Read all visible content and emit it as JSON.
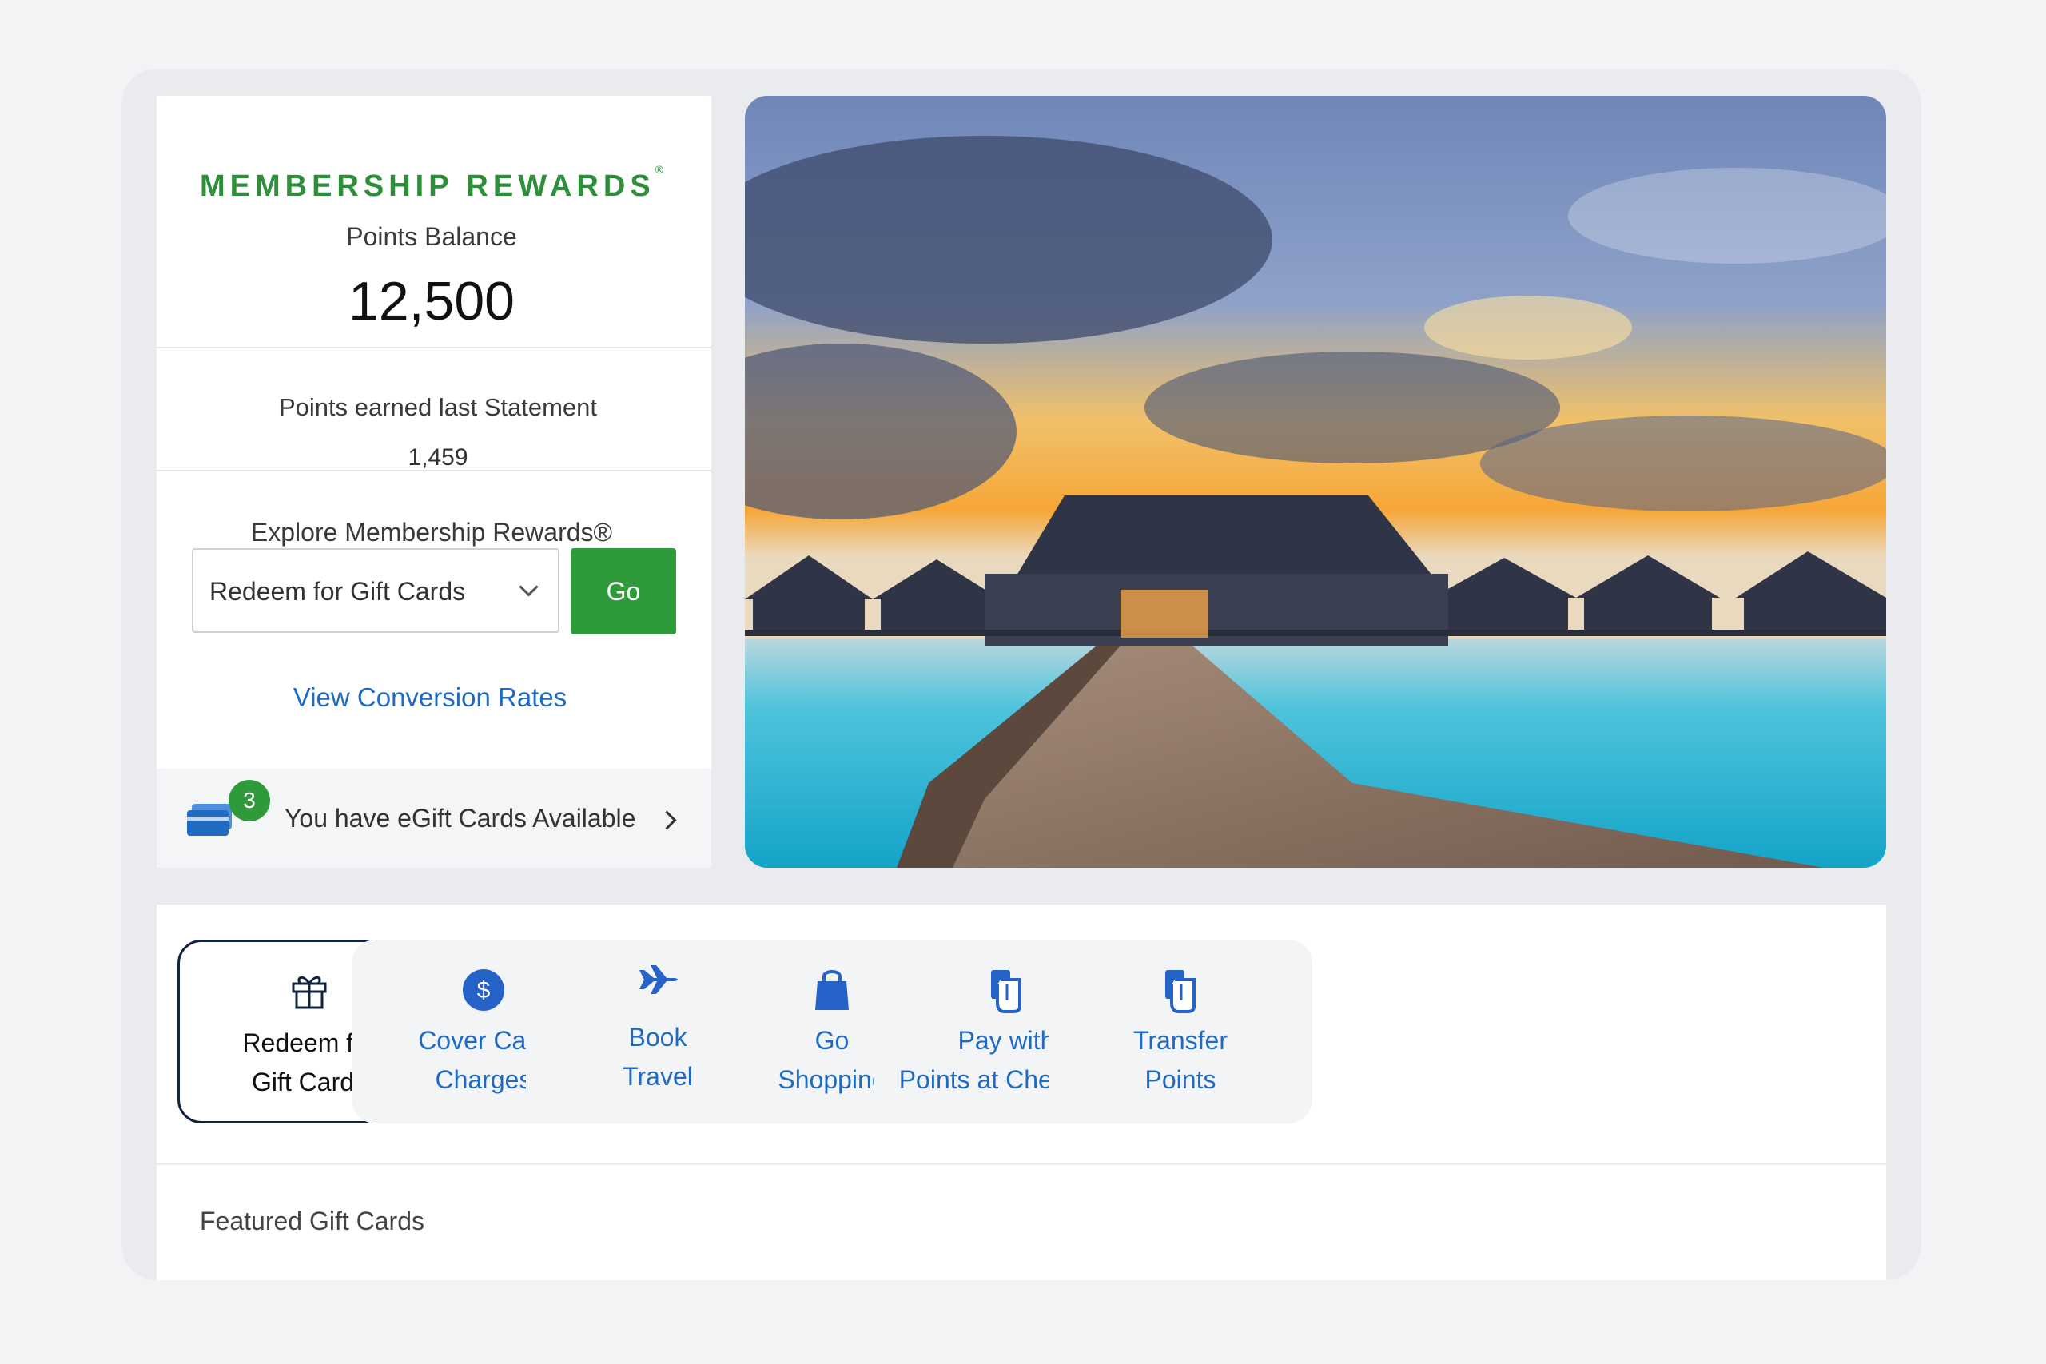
{
  "rewards": {
    "brand": "MEMBERSHIP REWARDS",
    "brand_mark": "®",
    "points_balance_label": "Points Balance",
    "points_balance": "12,500",
    "earned_label": "Points earned last Statement",
    "earned_value": "1,459",
    "explore_label": "Explore Membership Rewards®",
    "select_value": "Redeem for Gift Cards",
    "go_label": "Go",
    "conversion_link": "View Conversion Rates",
    "egift_count": "3",
    "egift_text": "You have eGift Cards Available"
  },
  "hero": {
    "icon": "overwater-bungalows-sunset-image"
  },
  "actions": [
    {
      "line1": "Redeem for",
      "line2": "Gift Cards",
      "icon": "gift-icon",
      "active": true
    },
    {
      "line1": "Cover Card",
      "line2": "Charges",
      "icon": "dollar-icon",
      "active": false
    },
    {
      "line1": "Book",
      "line2": "Travel",
      "icon": "airplane-icon",
      "active": false
    },
    {
      "line1": "Go",
      "line2": "Shopping",
      "icon": "shopping-bag-icon",
      "active": false
    },
    {
      "line1": "Pay with",
      "line2": "Points at Checkout",
      "icon": "pay-card-icon",
      "active": false
    },
    {
      "line1": "Transfer",
      "line2": "Points",
      "icon": "transfer-card-icon",
      "active": false
    }
  ],
  "featured_title": "Featured Gift Cards",
  "colors": {
    "brand_green": "#2e8f3a",
    "button_green": "#2e9a3a",
    "link_blue": "#1f6bc4",
    "icon_blue": "#2563c9",
    "active_border": "#10233f"
  }
}
